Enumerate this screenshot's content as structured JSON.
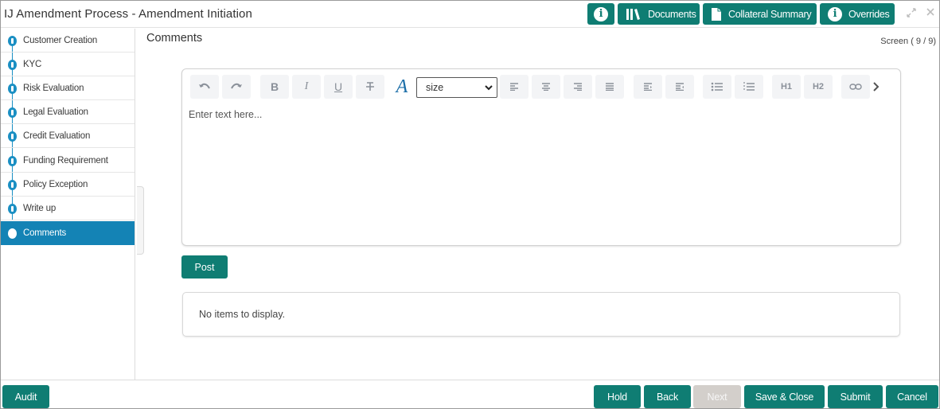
{
  "header": {
    "title": "IJ Amendment Process - Amendment Initiation",
    "info_icon": "info-icon",
    "documents_label": "Documents",
    "collateral_label": "Collateral Summary",
    "overrides_label": "Overrides",
    "maximize_icon": "maximize-icon",
    "close_icon": "close-icon"
  },
  "sidebar": {
    "items": [
      {
        "label": "Customer Creation"
      },
      {
        "label": "KYC"
      },
      {
        "label": "Risk Evaluation"
      },
      {
        "label": "Legal Evaluation"
      },
      {
        "label": "Credit Evaluation"
      },
      {
        "label": "Funding Requirement"
      },
      {
        "label": "Policy Exception"
      },
      {
        "label": "Write up"
      },
      {
        "label": "Comments",
        "active": true
      }
    ]
  },
  "main": {
    "title": "Comments",
    "screen_indicator": "Screen ( 9 / 9)"
  },
  "editor": {
    "size_select_value": "size",
    "placeholder": "Enter text here...",
    "toolbar_icons": [
      "undo-icon",
      "redo-icon",
      "bold-icon",
      "italic-icon",
      "underline-icon",
      "strikethrough-icon",
      "font-color-icon",
      "align-left-icon",
      "align-center-icon",
      "align-right-icon",
      "align-justify-icon",
      "indent-icon",
      "outdent-icon",
      "bullet-list-icon",
      "numbered-list-icon",
      "heading-1-icon",
      "heading-2-icon",
      "link-icon",
      "chevron-right-icon"
    ],
    "bold_label": "B",
    "italic_label": "I",
    "underline_label": "U",
    "font_label": "A",
    "h1_label": "H1",
    "h2_label": "H2"
  },
  "post_label": "Post",
  "list": {
    "empty_text": "No items to display."
  },
  "footer": {
    "audit_label": "Audit",
    "hold_label": "Hold",
    "back_label": "Back",
    "next_label": "Next",
    "save_close_label": "Save & Close",
    "submit_label": "Submit",
    "cancel_label": "Cancel"
  },
  "colors": {
    "primary": "#0f7d73",
    "sidebar_active": "#1483b5",
    "step_dot": "#1a8fc3",
    "disabled": "#d3cfcb"
  }
}
